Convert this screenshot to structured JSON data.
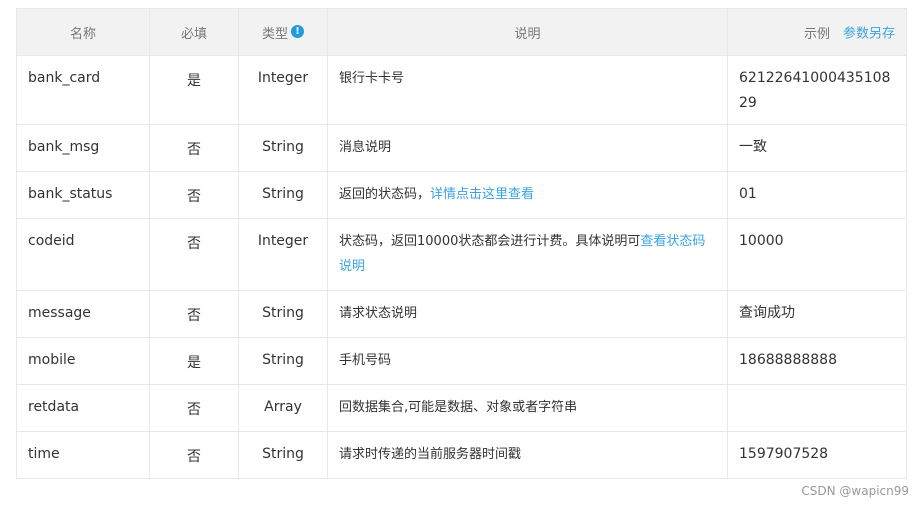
{
  "header": {
    "name": "名称",
    "required": "必填",
    "type": "类型",
    "type_info_icon": "!",
    "description": "说明",
    "example": "示例",
    "save_params": "参数另存"
  },
  "rows": [
    {
      "name": "bank_card",
      "required": "是",
      "type": "Integer",
      "description": "银行卡卡号",
      "example": "6212264100043510829"
    },
    {
      "name": "bank_msg",
      "required": "否",
      "type": "String",
      "description": "消息说明",
      "example": "一致"
    },
    {
      "name": "bank_status",
      "required": "否",
      "type": "String",
      "description": "返回的状态码，",
      "link": "详情点击这里查看",
      "example": "01"
    },
    {
      "name": "codeid",
      "required": "否",
      "type": "Integer",
      "description": "状态码，返回10000状态都会进行计费。具体说明可",
      "link": "查看状态码说明",
      "example": "10000"
    },
    {
      "name": "message",
      "required": "否",
      "type": "String",
      "description": "请求状态说明",
      "example": "查询成功"
    },
    {
      "name": "mobile",
      "required": "是",
      "type": "String",
      "description": "手机号码",
      "example": "18688888888"
    },
    {
      "name": "retdata",
      "required": "否",
      "type": "Array",
      "description": "回数据集合,可能是数据、对象或者字符串",
      "example": ""
    },
    {
      "name": "time",
      "required": "否",
      "type": "String",
      "description": "请求时传递的当前服务器时间戳",
      "example": "1597907528"
    }
  ],
  "watermark": "CSDN @wapicn99",
  "colors": {
    "link": "#3aa3e3",
    "info_icon": "#1f9bde",
    "header_bg": "#f2f2f2"
  },
  "icons": {
    "type_info": "info-circle-icon"
  }
}
